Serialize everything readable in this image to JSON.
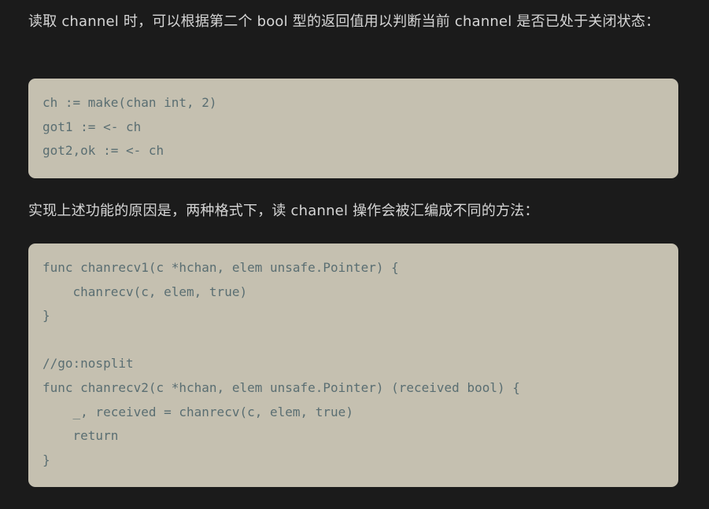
{
  "paragraphs": {
    "intro": "读取 channel 时，可以根据第二个 bool 型的返回值用以判断当前 channel 是否已处于关闭状态：",
    "explain": "实现上述功能的原因是，两种格式下，读 channel 操作会被汇编成不同的方法："
  },
  "code_block_1": {
    "lines": [
      "ch := make(chan int, 2)",
      "got1 := <- ch",
      "got2,ok := <- ch"
    ]
  },
  "code_block_2": {
    "lines": [
      "func chanrecv1(c *hchan, elem unsafe.Pointer) {",
      "    chanrecv(c, elem, true)",
      "}",
      "",
      "//go:nosplit",
      "func chanrecv2(c *hchan, elem unsafe.Pointer) (received bool) {",
      "    _, received = chanrecv(c, elem, true)",
      "    return",
      "}"
    ]
  },
  "colors": {
    "page_background": "#1b1b1b",
    "text": "#d6d6d6",
    "code_background": "#c5c0b0",
    "code_text": "#5a6e72"
  }
}
